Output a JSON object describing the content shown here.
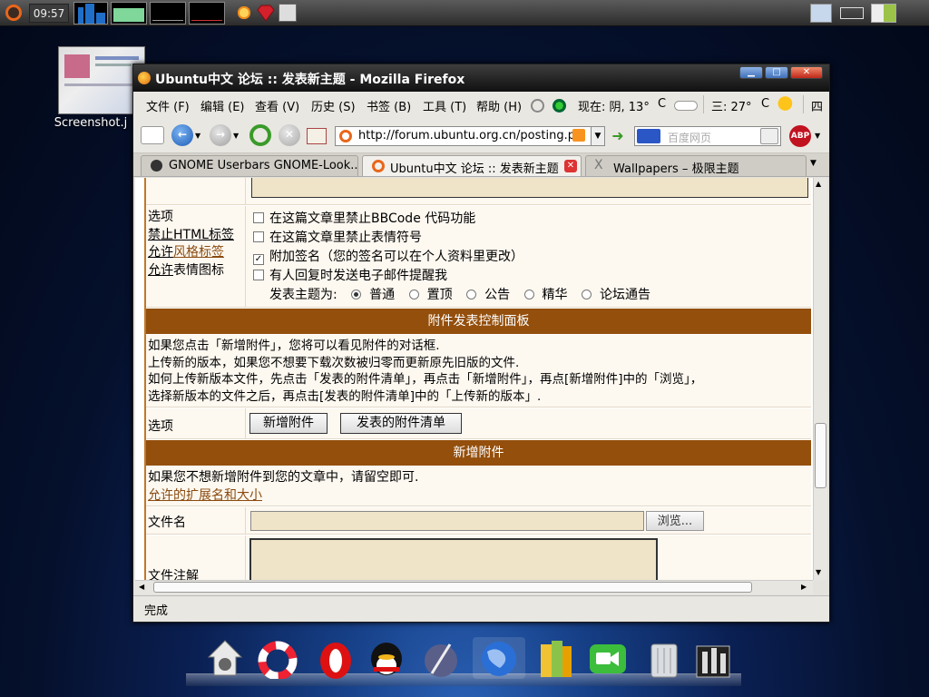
{
  "panel": {
    "clock": "09:57"
  },
  "desktop": {
    "icon_label": "Screenshot.j"
  },
  "window": {
    "title": "Ubuntu中文 论坛 :: 发表新主题 - Mozilla Firefox",
    "menus": [
      "文件 (F)",
      "编辑 (E)",
      "查看 (V)",
      "历史 (S)",
      "书签 (B)",
      "工具 (T)",
      "帮助 (H)"
    ],
    "weather_now": "现在: 阴, 13°",
    "weather_unit": "C",
    "weather_wed": "三: 27°",
    "weather_wed_unit": "C",
    "weather_next": "四",
    "url": "http://forum.ubuntu.org.cn/posting.pl",
    "search_placeholder": "百度网页",
    "tabs": [
      {
        "label": "GNOME Userbars GNOME-Look...",
        "active": false
      },
      {
        "label": "Ubuntu中文 论坛 :: 发表新主题",
        "active": true
      },
      {
        "label": "Wallpapers – 极限主题",
        "active": false
      }
    ],
    "status": "完成"
  },
  "form": {
    "options_label": "选项",
    "disable_html": "禁止HTML标签",
    "allow": "允许",
    "style_tags": "风格标签",
    "allow2": "允许",
    "emoticons": "表情图标",
    "checks": [
      {
        "label": "在这篇文章里禁止BBCode 代码功能",
        "checked": false
      },
      {
        "label": "在这篇文章里禁止表情符号",
        "checked": false
      },
      {
        "label": "附加签名（您的签名可以在个人资料里更改）",
        "checked": true
      },
      {
        "label": "有人回复时发送电子邮件提醒我",
        "checked": false
      }
    ],
    "post_type_label": "发表主题为:",
    "post_types": [
      {
        "label": "普通",
        "selected": true
      },
      {
        "label": "置顶",
        "selected": false
      },
      {
        "label": "公告",
        "selected": false
      },
      {
        "label": "精华",
        "selected": false
      },
      {
        "label": "论坛通告",
        "selected": false
      }
    ],
    "attach_panel_title": "附件发表控制面板",
    "attach_info": [
      "如果您点击「新增附件」，您将可以看见附件的对话框.",
      "上传新的版本，如果您不想要下载次数被归零而更新原先旧版的文件.",
      "如何上传新版本文件，先点击「发表的附件清单」，再点击「新增附件」，再点[新增附件]中的「浏览」，",
      "选择新版本的文件之后，再点击[发表的附件清单]中的「上传新的版本」."
    ],
    "options_label2": "选项",
    "add_attachment_btn": "新增附件",
    "posted_attachments_btn": "发表的附件清单",
    "new_attachment_title": "新增附件",
    "no_attach_hint": "如果您不想新增附件到您的文章中，请留空即可.",
    "allowed_ext_link": "允许的扩展名和大小",
    "filename_label": "文件名",
    "browse_btn": "浏览...",
    "file_comment_label": "文件注解"
  }
}
